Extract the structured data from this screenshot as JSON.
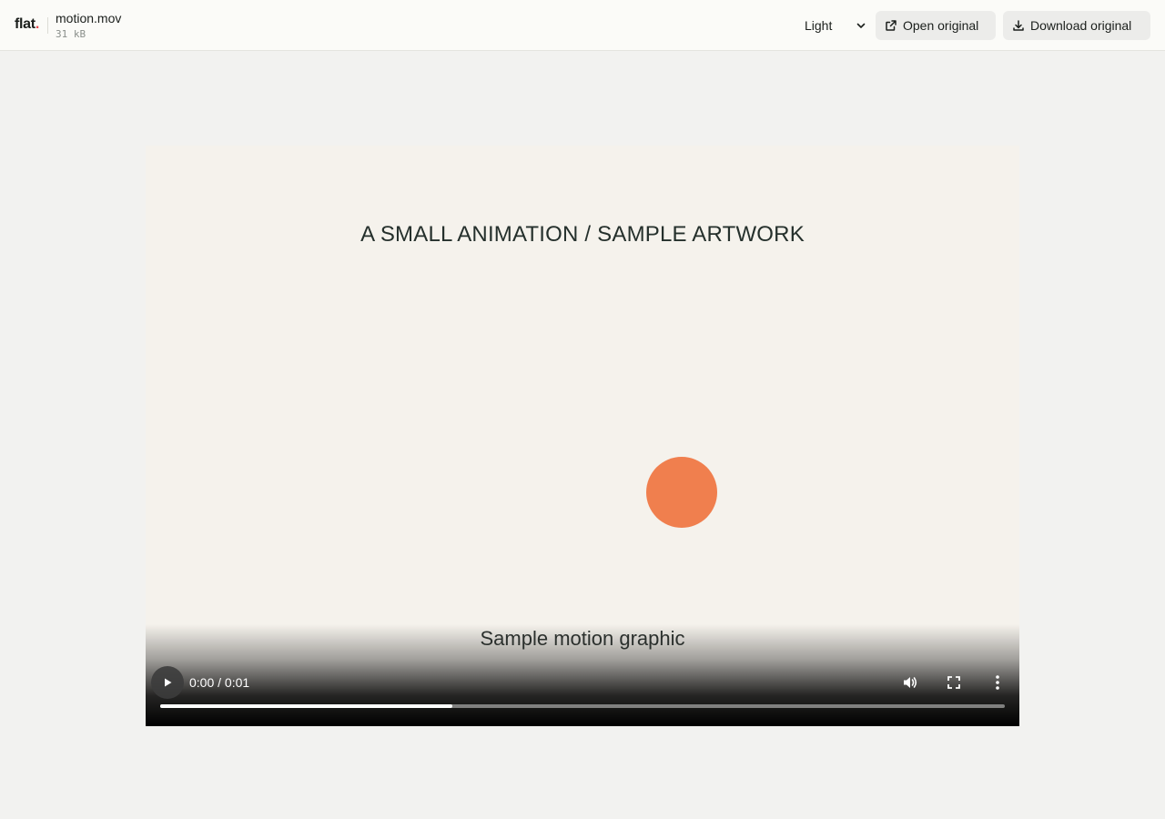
{
  "header": {
    "logo_text": "flat",
    "logo_dot": ".",
    "file_name": "motion.mov",
    "file_size": "31 kB",
    "theme_value": "Light",
    "open_label": "Open original",
    "download_label": "Download original"
  },
  "video": {
    "title": "A SMALL ANIMATION / SAMPLE ARTWORK",
    "caption": "Sample motion graphic",
    "time_display": "0:00 / 0:01",
    "progress_fraction": 0.346
  },
  "colors": {
    "accent_dot": "#e5484d",
    "ball": "#f07f4e",
    "video_bg": "#f5f2ec"
  },
  "icons": {
    "open": "external-link-icon",
    "download": "download-icon",
    "play": "play-icon",
    "volume": "volume-icon",
    "fullscreen": "fullscreen-icon",
    "more": "more-vertical-icon",
    "select": "chevron-down-icon"
  }
}
